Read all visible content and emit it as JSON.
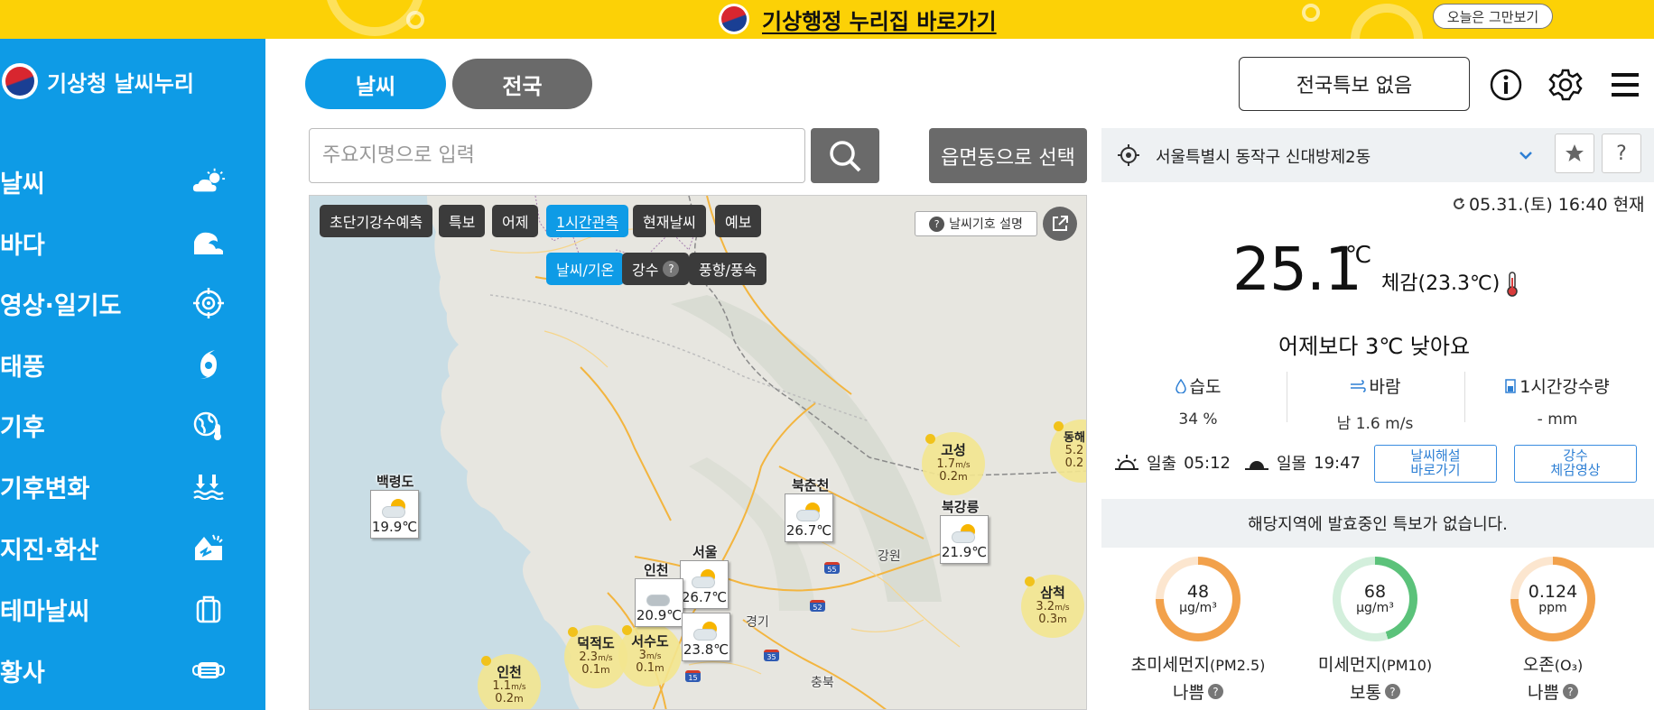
{
  "banner": {
    "link_text": "기상행정 누리집 바로가기",
    "close_label": "오늘은 그만보기"
  },
  "sidebar": {
    "brand": "기상청 날씨누리",
    "items": [
      {
        "label": "날씨",
        "icon": "weather-icon"
      },
      {
        "label": "바다",
        "icon": "wave-icon"
      },
      {
        "label": "영상·일기도",
        "icon": "radar-icon"
      },
      {
        "label": "태풍",
        "icon": "typhoon-icon"
      },
      {
        "label": "기후",
        "icon": "climate-globe-icon"
      },
      {
        "label": "기후변화",
        "icon": "climate-change-icon"
      },
      {
        "label": "지진·화산",
        "icon": "earthquake-icon"
      },
      {
        "label": "테마날씨",
        "icon": "suitcase-icon"
      },
      {
        "label": "황사",
        "icon": "mask-icon"
      }
    ],
    "color": "#0e9be6"
  },
  "header": {
    "tab_weather": "날씨",
    "tab_nation": "전국",
    "alert_status": "전국특보 없음"
  },
  "search": {
    "placeholder": "주요지명으로 입력",
    "dong_select": "읍면동으로 선택"
  },
  "map": {
    "tabs": [
      "초단기강수예측",
      "특보",
      "어제",
      "1시간관측",
      "현재날씨",
      "예보"
    ],
    "active_tab": "1시간관측",
    "subtabs": [
      "날씨/기온",
      "강수",
      "풍향/풍속"
    ],
    "subtab_help": "?",
    "legend_label": "날씨기호 설명",
    "stations": [
      {
        "name": "백령도",
        "temp": "19.9℃",
        "icon": "sun-cloud"
      },
      {
        "name": "북춘천",
        "temp": "26.7℃",
        "icon": "sun-cloud"
      },
      {
        "name": "북강릉",
        "temp": "21.9℃",
        "icon": "sun-cloud"
      },
      {
        "name": "서울",
        "temp": "26.7℃",
        "icon": "sun-cloud"
      },
      {
        "name": "인천",
        "temp": "20.9℃",
        "icon": "cloud"
      },
      {
        "name": "",
        "temp": "23.8℃",
        "icon": "sun-cloud"
      }
    ],
    "wind": [
      {
        "name": "고성",
        "speed": "1.7",
        "unit_s": "m/s",
        "wave": "0.2",
        "unit_m": "m"
      },
      {
        "name": "동해",
        "speed": "5.2",
        "unit_s": "",
        "wave": "0.2",
        "unit_m": ""
      },
      {
        "name": "삼척",
        "speed": "3.2",
        "unit_s": "m/s",
        "wave": "0.3",
        "unit_m": "m"
      },
      {
        "name": "덕적도",
        "speed": "2.3",
        "unit_s": "m/s",
        "wave": "0.1",
        "unit_m": "m"
      },
      {
        "name": "서수도",
        "speed": "3",
        "unit_s": "m/s",
        "wave": "0.1",
        "unit_m": "m"
      },
      {
        "name": "인천",
        "speed": "1.1",
        "unit_s": "m/s",
        "wave": "0.2",
        "unit_m": "m"
      }
    ],
    "region_labels": [
      "강원",
      "경기",
      "충북"
    ]
  },
  "panel": {
    "location": "서울특별시 동작구 신대방제2동",
    "timestamp": "05.31.(토) 16:40 현재",
    "temperature": "25.1",
    "temp_unit": "℃",
    "feels_like": "체감(23.3℃)",
    "compare": "어제보다 3℃ 낮아요",
    "humidity_label": "습도",
    "humidity_value": "34 %",
    "wind_label": "바람",
    "wind_value": "남 1.6 m/s",
    "rain_label": "1시간강수량",
    "rain_value": "- mm",
    "sunrise_label": "일출",
    "sunrise_time": "05:12",
    "sunset_label": "일몰",
    "sunset_time": "19:47",
    "link1_line1": "날씨해설",
    "link1_line2": "바로가기",
    "link2_line1": "강수",
    "link2_line2": "체감영상",
    "no_alert": "해당지역에 발효중인 특보가 없습니다.",
    "air": [
      {
        "value": "48",
        "unit": "μg/m³",
        "name": "초미세먼지",
        "sub": "(PM2.5)",
        "grade": "나쁨",
        "color": "#f2a14b",
        "fraction": 0.75
      },
      {
        "value": "68",
        "unit": "μg/m³",
        "name": "미세먼지",
        "sub": "(PM10)",
        "grade": "보통",
        "color": "#5bc27a",
        "fraction": 0.45
      },
      {
        "value": "0.124",
        "unit": "ppm",
        "name": "오존",
        "sub": "(O₃)",
        "grade": "나쁨",
        "color": "#f2a14b",
        "fraction": 0.75
      }
    ]
  }
}
